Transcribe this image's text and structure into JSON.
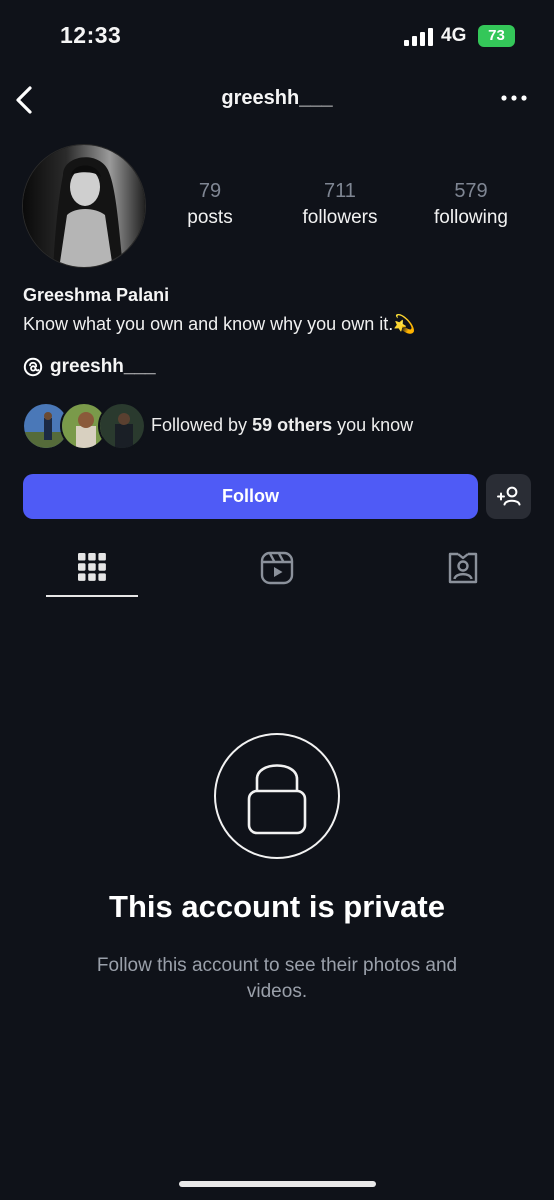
{
  "status_bar": {
    "time": "12:33",
    "network": "4G",
    "battery": "73",
    "battery_color": "#34c759"
  },
  "nav": {
    "title": "greeshh___",
    "back_icon": "chevron-left-icon",
    "more_icon": "more-horizontal-icon"
  },
  "profile": {
    "stats": [
      {
        "value": "79",
        "label": "posts"
      },
      {
        "value": "711",
        "label": "followers"
      },
      {
        "value": "579",
        "label": "following"
      }
    ],
    "full_name": "Greeshma Palani",
    "bio": "Know what you own and know why you own it.",
    "bio_emoji": "💫",
    "threads_handle": "greeshh___",
    "mutuals": {
      "prefix": "Followed by ",
      "highlight": "59 others",
      "suffix": " you know"
    }
  },
  "actions": {
    "follow_label": "Follow",
    "follow_color": "#4f5bf6",
    "suggest_icon": "add-person-icon"
  },
  "tabs": [
    {
      "name": "grid",
      "icon": "grid-icon",
      "selected": true
    },
    {
      "name": "reels",
      "icon": "reels-icon",
      "selected": false
    },
    {
      "name": "tagged",
      "icon": "tagged-icon",
      "selected": false
    }
  ],
  "private": {
    "title": "This account is private",
    "subtitle": "Follow this account to see their photos and videos."
  }
}
